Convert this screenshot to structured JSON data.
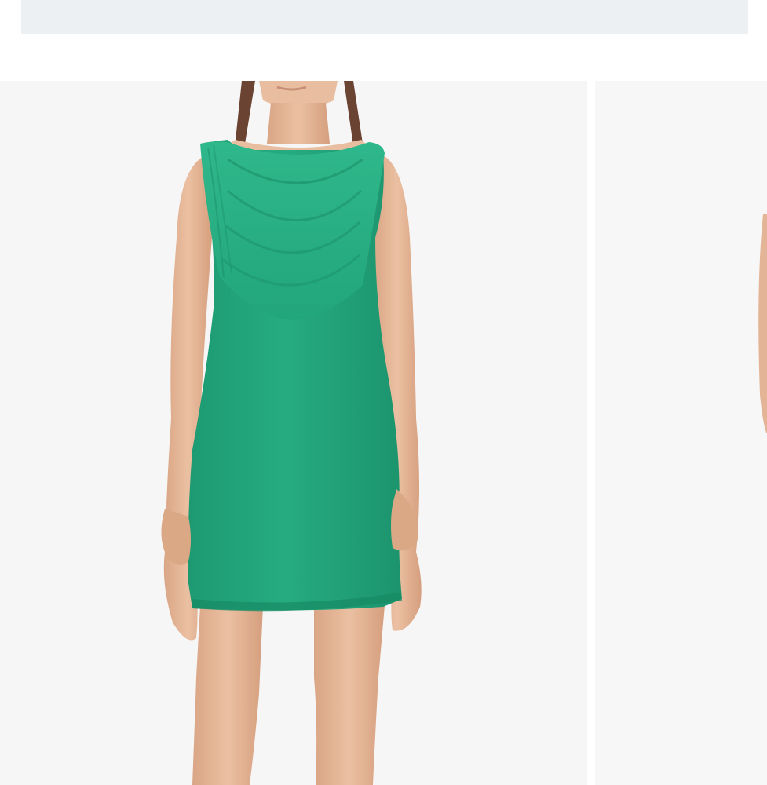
{
  "page": {
    "colors": {
      "banner": "#edf0f2",
      "photo_background": "#f6f6f6",
      "dress": "#22a57b",
      "skin": "#e6b898",
      "hair": "#6b4332"
    }
  },
  "gallery": {
    "images": [
      {
        "icon": "product-photo-front"
      },
      {
        "icon": "product-photo-side"
      }
    ]
  }
}
